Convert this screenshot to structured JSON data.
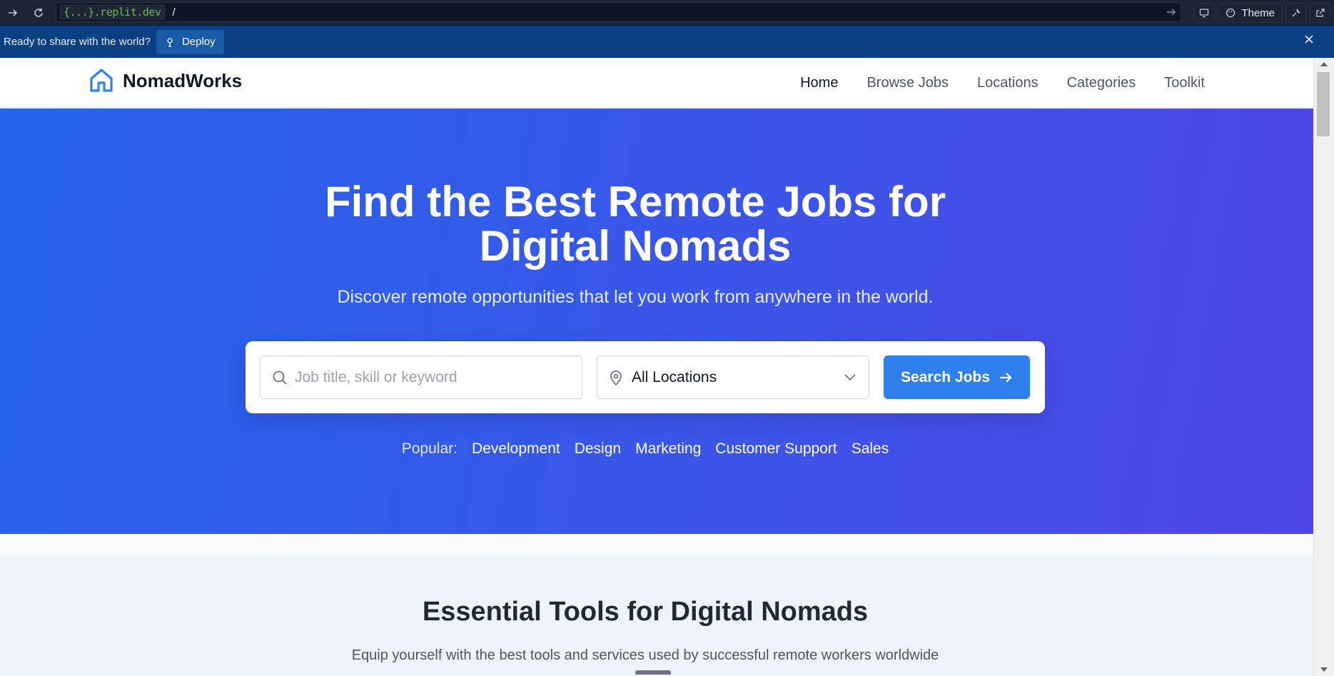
{
  "browser": {
    "url_chip_text": "{...}",
    "url_domain": ".replit.dev",
    "url_path": "/",
    "theme_label": "Theme"
  },
  "banner": {
    "text": "Ready to share with the world?",
    "deploy_label": "Deploy"
  },
  "site": {
    "logo_text": "NomadWorks",
    "nav": [
      "Home",
      "Browse Jobs",
      "Locations",
      "Categories",
      "Toolkit"
    ],
    "active_nav": "Home"
  },
  "hero": {
    "title": "Find the Best Remote Jobs for Digital Nomads",
    "subtitle": "Discover remote opportunities that let you work from anywhere in the world.",
    "search_placeholder": "Job title, skill or keyword",
    "location_value": "All Locations",
    "search_button": "Search Jobs",
    "popular_label": "Popular:",
    "popular_tags": [
      "Development",
      "Design",
      "Marketing",
      "Customer Support",
      "Sales"
    ]
  },
  "tools": {
    "title": "Essential Tools for Digital Nomads",
    "subtitle": "Equip yourself with the best tools and services used by successful remote workers worldwide"
  },
  "colors": {
    "primary": "#2f80ed",
    "hero_start": "#2563eb",
    "hero_end": "#4f46e5",
    "banner": "#0a3f83"
  },
  "icons": [
    "forward-icon",
    "reload-icon",
    "go-icon",
    "device-icon",
    "palette-icon",
    "wrench-icon",
    "open-external-icon",
    "deploy-icon",
    "close-icon",
    "home-logo-icon",
    "search-icon",
    "map-pin-icon",
    "chevron-down-icon",
    "arrow-right-icon"
  ]
}
